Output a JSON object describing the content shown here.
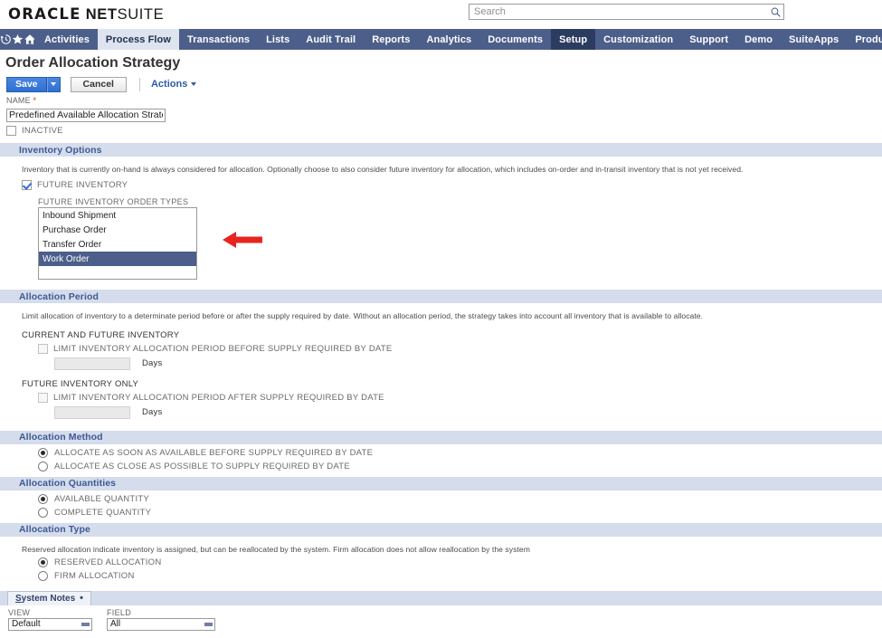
{
  "brand": {
    "oracle": "ORACLE",
    "net": " NET",
    "suite": "SUITE"
  },
  "search": {
    "placeholder": "Search",
    "value": "",
    "icon": "search-icon"
  },
  "nav": {
    "icons": [
      "history-icon",
      "star-icon",
      "home-icon"
    ],
    "items": [
      {
        "label": "Activities",
        "state": "normal"
      },
      {
        "label": "Process Flow",
        "state": "active"
      },
      {
        "label": "Transactions",
        "state": "normal"
      },
      {
        "label": "Lists",
        "state": "normal"
      },
      {
        "label": "Audit Trail",
        "state": "normal"
      },
      {
        "label": "Reports",
        "state": "normal"
      },
      {
        "label": "Analytics",
        "state": "normal"
      },
      {
        "label": "Documents",
        "state": "normal"
      },
      {
        "label": "Setup",
        "state": "highlight"
      },
      {
        "label": "Customization",
        "state": "normal"
      },
      {
        "label": "Support",
        "state": "normal"
      },
      {
        "label": "Demo",
        "state": "normal"
      },
      {
        "label": "SuiteApps",
        "state": "normal"
      },
      {
        "label": "Products",
        "state": "normal"
      }
    ]
  },
  "page": {
    "title": "Order Allocation Strategy"
  },
  "toolbar": {
    "save_label": "Save",
    "cancel_label": "Cancel",
    "actions_label": "Actions"
  },
  "name_field": {
    "label": "NAME",
    "required_marker": "*",
    "value": "Predefined Available Allocation Strategy"
  },
  "inactive": {
    "label": "INACTIVE",
    "checked": false
  },
  "inventory_options": {
    "title": "Inventory Options",
    "help": "Inventory that is currently on-hand is always considered for allocation. Optionally choose to also consider future inventory for allocation, which includes on-order and in-transit inventory that is not yet received.",
    "future_inventory": {
      "label": "FUTURE INVENTORY",
      "checked": true
    },
    "order_types": {
      "label": "FUTURE INVENTORY ORDER TYPES",
      "options": [
        {
          "label": "Inbound Shipment",
          "selected": false
        },
        {
          "label": "Purchase Order",
          "selected": false
        },
        {
          "label": "Transfer Order",
          "selected": false
        },
        {
          "label": "Work Order",
          "selected": true
        }
      ]
    },
    "annotation": {
      "type": "arrow-left",
      "color": "#e8241f",
      "points_to": "Work Order"
    }
  },
  "allocation_period": {
    "title": "Allocation Period",
    "help": "Limit allocation of inventory to a determinate period before or after the supply required by date. Without an allocation period, the strategy takes into account all inventory that is available to allocate.",
    "current_future_group": {
      "label": "CURRENT AND FUTURE INVENTORY",
      "checkbox_label": "LIMIT INVENTORY ALLOCATION PERIOD BEFORE SUPPLY REQUIRED BY DATE",
      "checked": false,
      "days_value": "",
      "days_unit": "Days"
    },
    "future_only_group": {
      "label": "FUTURE INVENTORY ONLY",
      "checkbox_label": "LIMIT INVENTORY ALLOCATION PERIOD AFTER SUPPLY REQUIRED BY DATE",
      "checked": false,
      "days_value": "",
      "days_unit": "Days"
    }
  },
  "allocation_method": {
    "title": "Allocation Method",
    "options": [
      {
        "label": "ALLOCATE AS SOON AS AVAILABLE BEFORE SUPPLY REQUIRED BY DATE",
        "selected": true
      },
      {
        "label": "ALLOCATE AS CLOSE AS POSSIBLE TO SUPPLY REQUIRED BY DATE",
        "selected": false
      }
    ]
  },
  "allocation_quantities": {
    "title": "Allocation Quantities",
    "options": [
      {
        "label": "AVAILABLE QUANTITY",
        "selected": true
      },
      {
        "label": "COMPLETE QUANTITY",
        "selected": false
      }
    ]
  },
  "allocation_type": {
    "title": "Allocation Type",
    "help": "Reserved allocation indicate inventory is assigned, but can be reallocated by the system. Firm allocation does not allow reallocation by the system",
    "options": [
      {
        "label": "RESERVED ALLOCATION",
        "selected": true
      },
      {
        "label": "FIRM ALLOCATION",
        "selected": false
      }
    ]
  },
  "system_notes": {
    "tab_label": "System Notes",
    "tab_marker": "•",
    "view": {
      "label": "VIEW",
      "value": "Default"
    },
    "field": {
      "label": "FIELD",
      "value": "All"
    }
  }
}
